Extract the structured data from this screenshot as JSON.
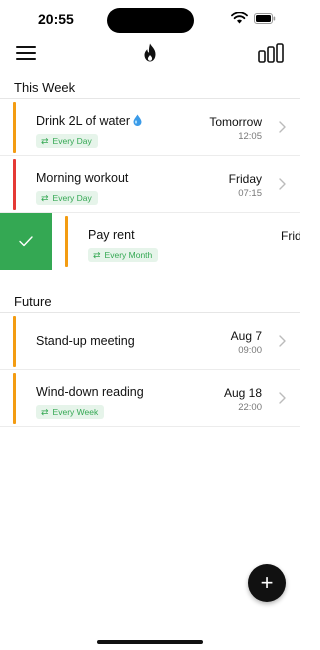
{
  "status_bar": {
    "time": "20:55"
  },
  "header": {
    "menu_icon": "menu-icon",
    "logo_icon": "flame-icon",
    "stats_icon": "stats-icon"
  },
  "sections": [
    {
      "title": "This Week",
      "tasks": [
        {
          "title": "Drink 2L of water",
          "emoji_icon": "water-drop-icon",
          "repeat": "Every Day",
          "day": "Tomorrow",
          "time": "12:05",
          "accent": "#f39c12"
        },
        {
          "title": "Morning workout",
          "repeat": "Every Day",
          "day": "Friday",
          "time": "07:15",
          "accent": "#e53935"
        },
        {
          "title": "Pay rent",
          "repeat": "Every Month",
          "day": "Frid",
          "accent": "#f39c12",
          "swiped": true
        }
      ]
    },
    {
      "title": "Future",
      "tasks": [
        {
          "title": "Stand-up meeting",
          "day": "Aug 7",
          "time": "09:00",
          "accent": "#f39c12"
        },
        {
          "title": "Wind-down reading",
          "repeat": "Every Week",
          "day": "Aug 18",
          "time": "22:00",
          "accent": "#f39c12"
        }
      ]
    }
  ],
  "actions": {
    "complete_icon": "check-icon",
    "add_label": "+"
  },
  "colors": {
    "swipe_complete": "#34a853",
    "badge_bg": "#e6f4ea",
    "badge_text": "#34a853"
  }
}
